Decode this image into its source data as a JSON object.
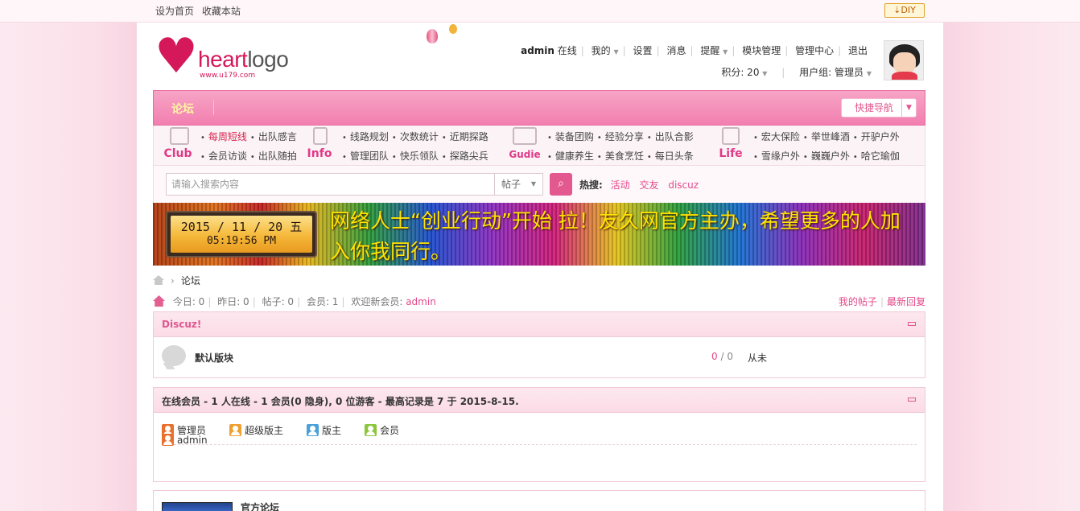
{
  "topbar": {
    "set_home": "设为首页",
    "bookmark": "收藏本站",
    "diy": "⇣DIY"
  },
  "logo": {
    "heart": "♥",
    "word_a": "heart",
    "word_b": "logo",
    "url": "www.u179.com"
  },
  "usernav": {
    "username": "admin",
    "status": "在线",
    "mine": "我的",
    "settings": "设置",
    "messages": "消息",
    "reminders": "提醒",
    "module_manage": "模块管理",
    "admin_center": "管理中心",
    "logout": "退出",
    "points": "积分: 20",
    "usergroup": "用户组: 管理员"
  },
  "navbar": {
    "forum": "论坛",
    "quick_nav": "快捷导航"
  },
  "categories": [
    {
      "label": "Club",
      "row1": [
        "每周短线",
        "出队感言"
      ],
      "row2": [
        "会员访谈",
        "出队随拍"
      ]
    },
    {
      "label": "Info",
      "row1": [
        "线路规划",
        "次数统计",
        "近期探路"
      ],
      "row2": [
        "管理团队",
        "快乐领队",
        "探路尖兵"
      ]
    },
    {
      "label": "Gudie",
      "row1": [
        "装备团购",
        "经验分享",
        "出队合影"
      ],
      "row2": [
        "健康养生",
        "美食烹饪",
        "每日头条"
      ]
    },
    {
      "label": "Life",
      "row1": [
        "宏大保险",
        "举世峰酒",
        "开驴户外"
      ],
      "row2": [
        "雪缘户外",
        "巍巍户外",
        "哈它瑜伽"
      ]
    }
  ],
  "search": {
    "placeholder": "请输入搜索内容",
    "type": "帖子",
    "hot_label": "热搜:",
    "hot_tags": [
      "活动",
      "交友",
      "discuz"
    ]
  },
  "banner": {
    "date": "2015 / 11 / 20  五",
    "time": "05:19:56  PM",
    "message": "网络人士“创业行动”开始 拉！友久网官方主办，希望更多的人加入你我同行。"
  },
  "breadcrumb": {
    "current": "论坛"
  },
  "stats": {
    "today": "今日: 0",
    "yesterday": "昨日: 0",
    "posts": "帖子: 0",
    "members": "会员: 1",
    "welcome": "欢迎新会员:",
    "new_member": "admin",
    "my_posts": "我的帖子",
    "latest_replies": "最新回复"
  },
  "forum_box": {
    "title": "Discuz!",
    "forum_name": "默认版块",
    "count_threads": "0",
    "count_sep": " / ",
    "count_posts": "0",
    "last_post": "从未"
  },
  "online_box": {
    "title": "在线会员 - 1 人在线 - 1 会员(0 隐身), 0 位游客 - 最高记录是 7 于 2015-8-15.",
    "legend": [
      {
        "label": "管理员",
        "color": "#e8702c"
      },
      {
        "label": "超级版主",
        "color": "#f0a030"
      },
      {
        "label": "版主",
        "color": "#4aa0d8"
      },
      {
        "label": "会员",
        "color": "#8cc63a"
      }
    ],
    "online_user": "admin"
  },
  "official_box": {
    "title": "官方论坛"
  },
  "colors": {
    "accent": "#e24a8a",
    "nav_pink": "#f27fb0",
    "banner_text": "#ffe400"
  }
}
